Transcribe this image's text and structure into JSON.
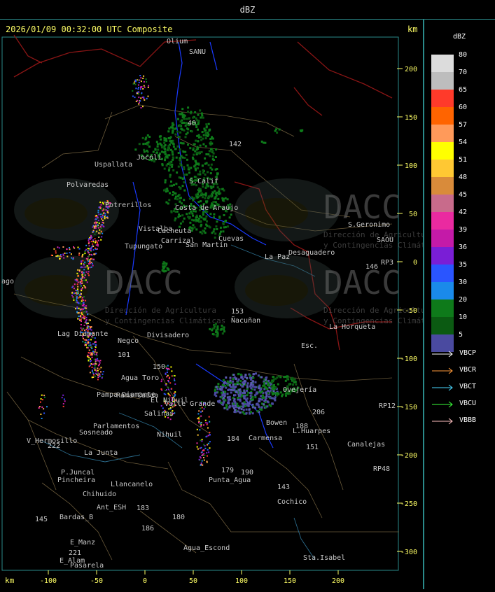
{
  "header": {
    "title": "dBZ"
  },
  "map": {
    "timestamp": "2026/01/09 00:32:00 UTC Composite",
    "km_label": "km",
    "x_ticks": [
      "-100",
      "-50",
      "0",
      "50",
      "100",
      "150",
      "200"
    ],
    "y_ticks": [
      "200",
      "150",
      "100",
      "50",
      "0",
      "-50",
      "-100",
      "-150",
      "-200",
      "-250",
      "-300"
    ],
    "watermark_text": "DACC",
    "watermark_sub1": "Dirección de Agricultura",
    "watermark_sub2": "y Contingencias Climáticas",
    "places": [
      "Olium",
      "SANU",
      "Uspallata",
      "Polvaredas",
      "Potrerillos",
      "Cacheuta",
      "Tupungato",
      "Carrizal",
      "San Martín",
      "Costa de Araujo",
      "La Paz",
      "Desaguadero",
      "S.Geronimo",
      "SAOU",
      "Lag Diamante",
      "El Nihuil",
      "Ñacuñan",
      "Divisadero",
      "Agua Toro",
      "Pampa Diamante",
      "Valle Grande",
      "Salinas",
      "Parlamentos",
      "Sosneado",
      "V_Hermosillo",
      "La Junta",
      "P.Juncal",
      "Pincheira",
      "Llancanelo",
      "Chihuido",
      "Ant_ESH",
      "Bardas_B",
      "E_Manz",
      "E_Alam",
      "Pasarela",
      "Agua_Escond",
      "Punta_Agua",
      "Canalejas",
      "L.Huarpes",
      "Ovejería",
      "Carmensa",
      "Bowen",
      "Cochico",
      "Sta.Isabel",
      "La Horqueta",
      "Esc.",
      "RP3",
      "RP12",
      "RP48",
      "146",
      "142",
      "153",
      "145",
      "151",
      "143",
      "184",
      "179",
      "190",
      "180",
      "186",
      "183",
      "222",
      "206",
      "188",
      "101",
      "40",
      "150",
      "221",
      "ago",
      "Nihuil",
      "Rama Caída",
      "Negco",
      "Cuevas",
      "Vistalba",
      "S.Calif",
      "Jocoli"
    ]
  },
  "legend": {
    "title": "dBZ",
    "scale": [
      {
        "label": "80",
        "color": "#dcdcdc"
      },
      {
        "label": "70",
        "color": "#bdbdbd"
      },
      {
        "label": "65",
        "color": "#ff3a2a"
      },
      {
        "label": "60",
        "color": "#ff6400"
      },
      {
        "label": "57",
        "color": "#ff9a5a"
      },
      {
        "label": "54",
        "color": "#ffff00"
      },
      {
        "label": "51",
        "color": "#ffc833"
      },
      {
        "label": "48",
        "color": "#d98b3a"
      },
      {
        "label": "45",
        "color": "#c86b8b"
      },
      {
        "label": "42",
        "color": "#ea2aa0"
      },
      {
        "label": "39",
        "color": "#c41aa8"
      },
      {
        "label": "36",
        "color": "#7a1ed6"
      },
      {
        "label": "35",
        "color": "#2a55ff"
      },
      {
        "label": "30",
        "color": "#1a8aea"
      },
      {
        "label": "20",
        "color": "#0e7a1a"
      },
      {
        "label": "10",
        "color": "#0b5a12"
      },
      {
        "label": "5",
        "color": "#4a4aa0"
      }
    ],
    "radars": [
      {
        "label": "VBCP",
        "color": "#ffffff"
      },
      {
        "label": "VBCR",
        "color": "#ff9a3a"
      },
      {
        "label": "VBCT",
        "color": "#4ad8ff"
      },
      {
        "label": "VBCU",
        "color": "#3aff3a"
      },
      {
        "label": "VBBB",
        "color": "#ffc0c0"
      }
    ]
  }
}
